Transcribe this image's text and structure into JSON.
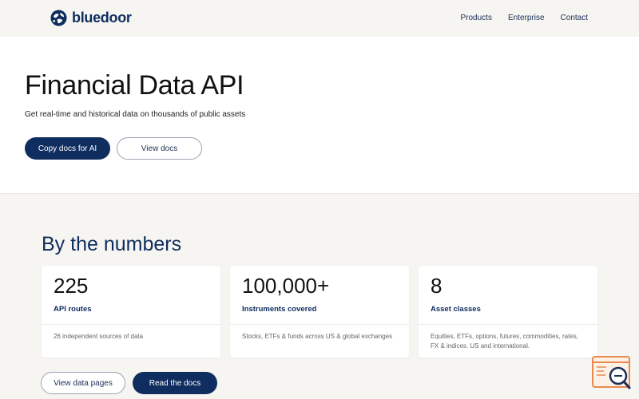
{
  "nav": {
    "brand": "bluedoor",
    "links": [
      "Products",
      "Enterprise",
      "Contact"
    ]
  },
  "hero": {
    "title": "Financial Data API",
    "subtitle": "Get real-time and historical data on thousands of public assets",
    "primary_button": "Copy docs for AI",
    "secondary_button": "View docs"
  },
  "numbers": {
    "title": "By the numbers",
    "cards": [
      {
        "value": "225",
        "label": "API routes",
        "description": "26 independent sources of data"
      },
      {
        "value": "100,000+",
        "label": "Instruments covered",
        "description": "Stocks, ETFs & funds across US & global exchanges"
      },
      {
        "value": "8",
        "label": "Asset classes",
        "description": "Equities, ETFs, options, futures, commodities, rates, FX & indices. US and international."
      }
    ],
    "secondary_button": "View data pages",
    "primary_button": "Read the docs"
  },
  "icons": {
    "logo": "globe-logo-icon",
    "help": "search-help-icon"
  },
  "colors": {
    "brand": "#0f2d5e",
    "page_background": "#f6f5f1",
    "help_widget": "#e8894f"
  }
}
